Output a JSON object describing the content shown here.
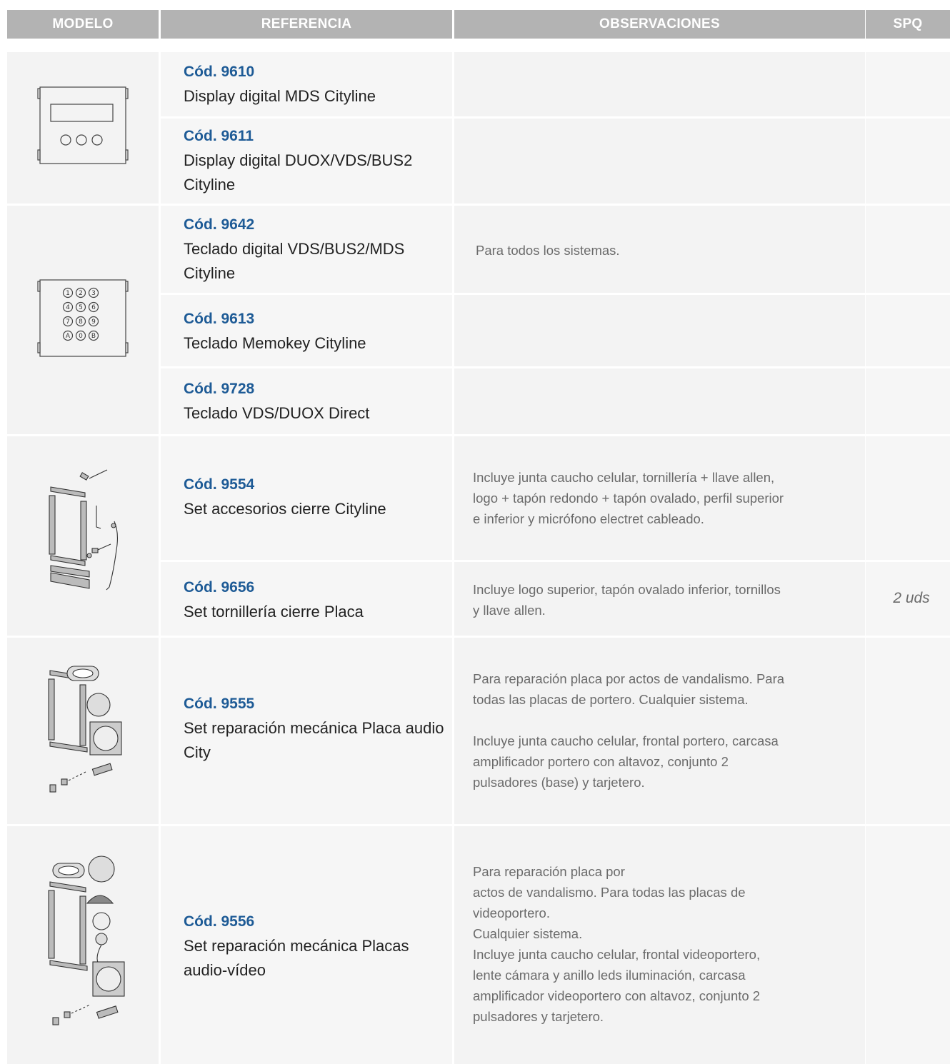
{
  "header": {
    "modelo": "MODELO",
    "referencia": "REFERENCIA",
    "observaciones": "OBSERVACIONES",
    "spq": "SPQ"
  },
  "rows": [
    {
      "code": "Cód. 9610",
      "name": "Display digital MDS Cityline"
    },
    {
      "code": "Cód. 9611",
      "name": "Display digital DUOX/VDS/BUS2 Cityline"
    },
    {
      "code": "Cód. 9642",
      "name": "Teclado digital VDS/BUS2/MDS Cityline"
    },
    {
      "code": "Cód. 9613",
      "name": "Teclado Memokey Cityline"
    },
    {
      "code": "Cód. 9728",
      "name": "Teclado VDS/DUOX Direct"
    },
    {
      "code": "Cód. 9554",
      "name": "Set accesorios cierre Cityline",
      "obs": [
        "Incluye junta caucho celular, tornillería + llave allen,",
        "logo + tapón redondo + tapón ovalado, perfil superior",
        "e inferior y micrófono electret cableado."
      ]
    },
    {
      "code": "Cód. 9656",
      "name": "Set tornillería cierre Placa",
      "obs": [
        "Incluye logo superior, tapón ovalado inferior, tornillos",
        "y llave allen."
      ],
      "spq": "2 uds"
    },
    {
      "code": "Cód. 9555",
      "name": "Set reparación mecánica Placa audio City",
      "obs": [
        "Para reparación placa por actos de vandalismo. Para",
        "todas las placas de portero. Cualquier sistema.",
        "",
        "Incluye junta caucho celular, frontal portero, carcasa",
        "amplificador portero con altavoz, conjunto 2",
        "pulsadores (base) y tarjetero."
      ]
    },
    {
      "code": "Cód. 9556",
      "name": "Set reparación mecánica Placas audio-vídeo",
      "obs": [
        "Para reparación placa por",
        "actos de vandalismo. Para todas las placas de",
        "videoportero.",
        "Cualquier sistema.",
        "Incluye junta caucho celular, frontal videoportero,",
        "lente cámara y anillo leds iluminación, carcasa",
        "amplificador videoportero con altavoz, conjunto 2",
        "pulsadores y tarjetero."
      ]
    }
  ],
  "group_obs": {
    "keyboards": "Para todos los sistemas."
  },
  "keypad": {
    "key_1": "1",
    "key_2": "2",
    "key_3": "3",
    "key_4": "4",
    "key_5": "5",
    "key_6": "6",
    "key_7": "7",
    "key_8": "8",
    "key_9": "9",
    "key_a": "A",
    "key_0": "0",
    "key_b": "B"
  },
  "colors": {
    "header_bg": "#b3b3b3",
    "code_blue": "#1e5b96"
  }
}
